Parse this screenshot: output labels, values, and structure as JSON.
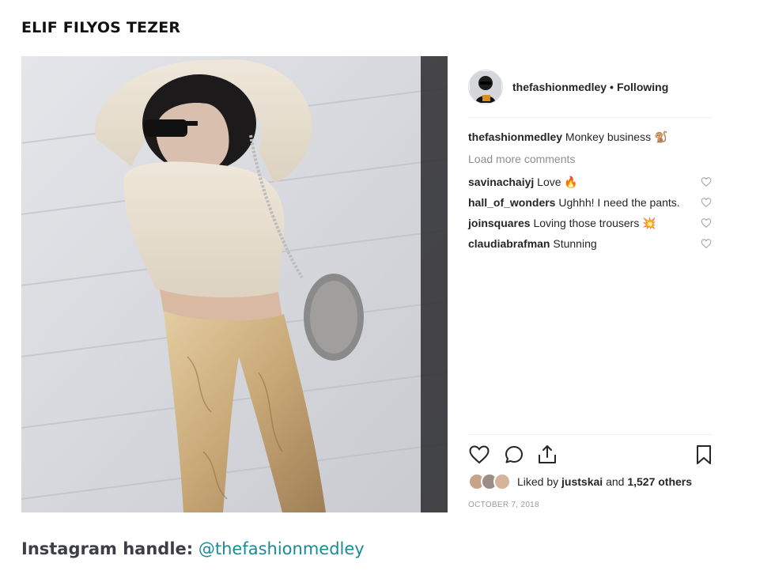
{
  "article": {
    "title": "ELIF FILYOS TEZER"
  },
  "post": {
    "username": "thefashionmedley",
    "separator": "•",
    "follow_status": "Following",
    "caption": {
      "user": "thefashionmedley",
      "text": "Monkey business",
      "emoji": "🐒"
    },
    "load_more": "Load more comments",
    "comments": [
      {
        "user": "savinachaiyj",
        "text": "Love",
        "emoji": "🔥"
      },
      {
        "user": "hall_of_wonders",
        "text": "Ughhh! I need the pants.",
        "emoji": ""
      },
      {
        "user": "joinsquares",
        "text": "Loving those trousers",
        "emoji": "💥"
      },
      {
        "user": "claudiabrafman",
        "text": "Stunning",
        "emoji": ""
      }
    ],
    "likes": {
      "prefix": "Liked by",
      "user": "justskai",
      "conjunction": "and",
      "others": "1,527 others"
    },
    "date": "OCTOBER 7, 2018"
  },
  "footer": {
    "label": "Instagram handle:",
    "handle": "@thefashionmedley"
  },
  "colors": {
    "handle_link": "#1a8a99",
    "text": "#262626",
    "muted": "#8e8e8e"
  },
  "icons": [
    "heart-icon",
    "comment-icon",
    "share-icon",
    "bookmark-icon"
  ]
}
